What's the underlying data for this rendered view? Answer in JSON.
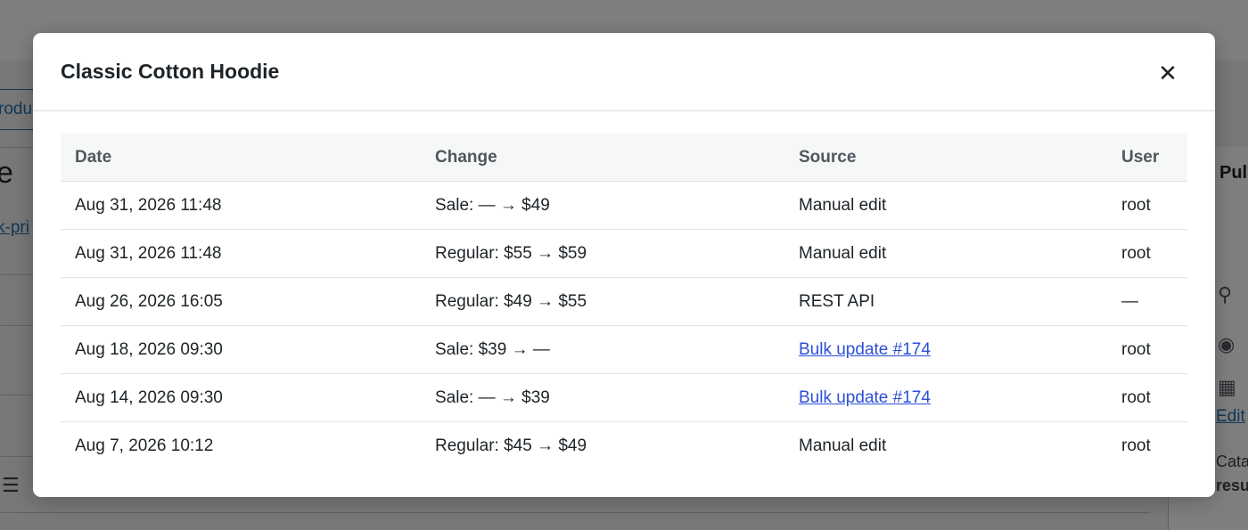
{
  "modal": {
    "title": "Classic Cotton Hoodie",
    "close_glyph": "✕",
    "columns": {
      "date": "Date",
      "change": "Change",
      "source": "Source",
      "user": "User"
    },
    "rows": [
      {
        "date": "Aug 31, 2026 11:48",
        "change": "Sale: — → $49",
        "source": "Manual edit",
        "source_is_link": false,
        "user": "root"
      },
      {
        "date": "Aug 31, 2026 11:48",
        "change": "Regular: $55 → $59",
        "source": "Manual edit",
        "source_is_link": false,
        "user": "root"
      },
      {
        "date": "Aug 26, 2026 16:05",
        "change": "Regular: $49 → $55",
        "source": "REST API",
        "source_is_link": false,
        "user": "—"
      },
      {
        "date": "Aug 18, 2026 09:30",
        "change": "Sale: $39 → —",
        "source": "Bulk update #174",
        "source_is_link": true,
        "user": "root"
      },
      {
        "date": "Aug 14, 2026 09:30",
        "change": "Sale: — → $39",
        "source": "Bulk update #174",
        "source_is_link": true,
        "user": "root"
      },
      {
        "date": "Aug 7, 2026 10:12",
        "change": "Regular: $45 → $49",
        "source": "Manual edit",
        "source_is_link": false,
        "user": "root"
      }
    ]
  },
  "background": {
    "tab_fragment": "rodu",
    "title_fragment": "e",
    "link_fragment": "k-pri",
    "panel_heading_fragment": "Pul",
    "panel_link_fragment": "Edit",
    "panel_text_1": "Cata",
    "panel_text_2": "resu",
    "icons": [
      "pin-icon",
      "eye-icon",
      "calendar-icon",
      "list-icon"
    ]
  },
  "colors": {
    "overlay": "rgba(0,0,0,0.5)",
    "link": "#2c4fd8",
    "header_bg": "#f6f7f7"
  }
}
